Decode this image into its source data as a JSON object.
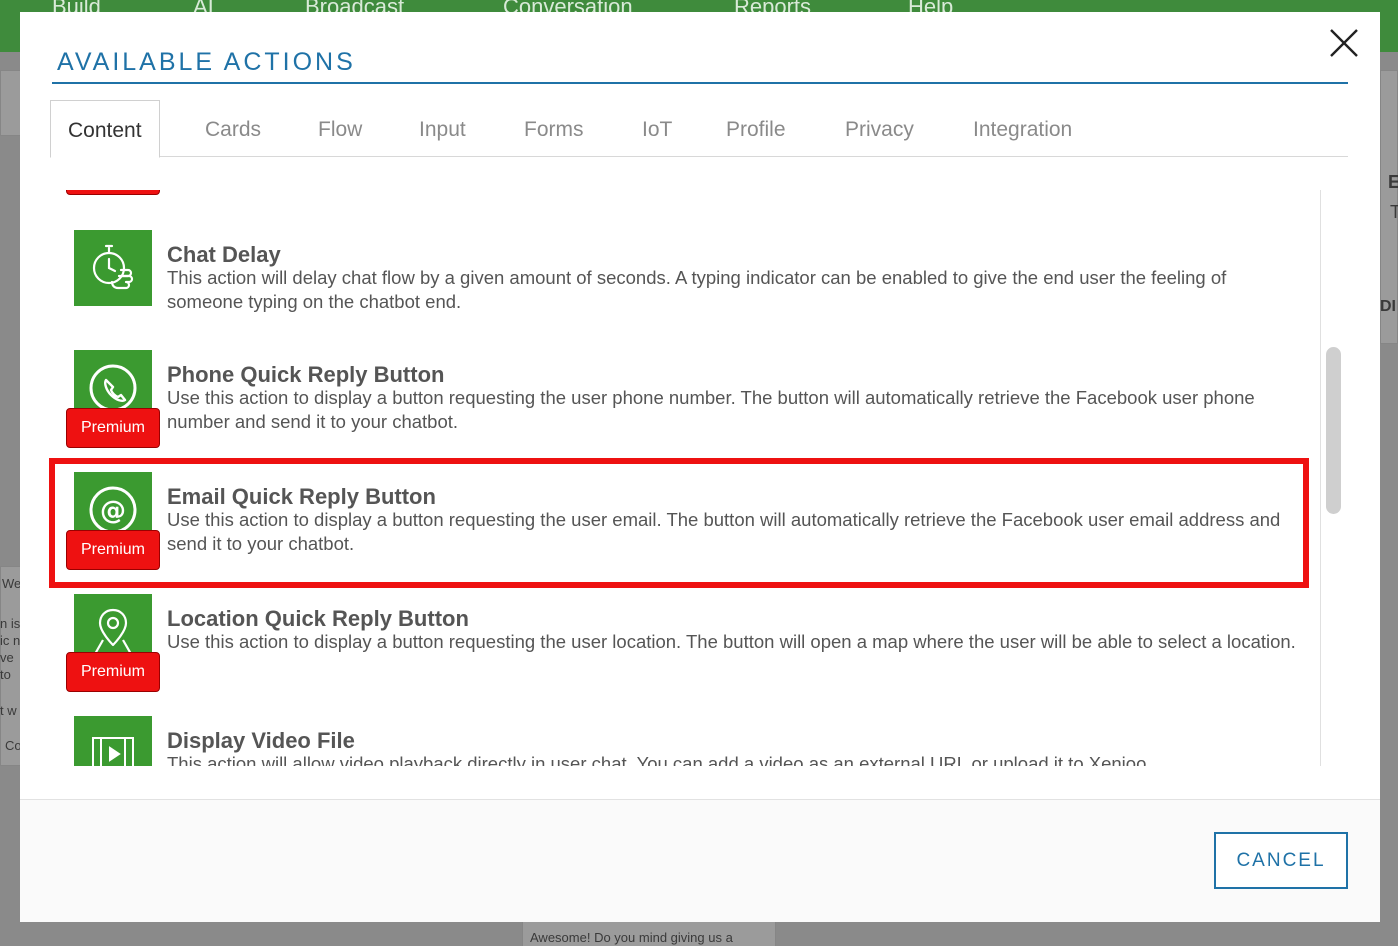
{
  "background": {
    "nav_items": [
      "Build",
      "AI",
      "Broadcast",
      "Conversation",
      "Reports",
      "Help"
    ],
    "snippets": [
      "We",
      "n is",
      "ic no",
      "ve",
      "to",
      "t w",
      "Co",
      "Awesome! Do you mind giving us a",
      "E",
      "T",
      "DI"
    ]
  },
  "modal": {
    "title": "AVAILABLE ACTIONS",
    "close_icon": "close-icon",
    "tabs": [
      {
        "label": "Content",
        "active": true
      },
      {
        "label": "Cards"
      },
      {
        "label": "Flow"
      },
      {
        "label": "Input"
      },
      {
        "label": "Forms"
      },
      {
        "label": "IoT"
      },
      {
        "label": "Profile"
      },
      {
        "label": "Privacy"
      },
      {
        "label": "Integration"
      }
    ],
    "actions": [
      {
        "name": "Chat Delay",
        "description": "This action will delay chat flow by a given amount of seconds. A typing indicator can be enabled to give the end user the feeling of someone typing on the chatbot end.",
        "icon": "stopwatch-hand-icon"
      },
      {
        "name": "Phone Quick Reply Button",
        "description": "Use this action to display a button requesting the user phone number. The button will automatically retrieve the Facebook user phone number and send it to your chatbot.",
        "icon": "phone-icon",
        "badge": "Premium"
      },
      {
        "name": "Email Quick Reply Button",
        "description": "Use this action to display a button requesting the user email. The button will automatically retrieve the Facebook user email address and send it to your chatbot.",
        "icon": "at-sign-icon",
        "badge": "Premium"
      },
      {
        "name": "Location Quick Reply Button",
        "description": "Use this action to display a button requesting the user location. The button will open a map where the user will be able to select a location.",
        "icon": "map-pin-icon",
        "badge": "Premium"
      },
      {
        "name": "Display Video File",
        "description": "This action will allow video playback directly in user chat. You can add a video as an external URL or upload it to Xenioo",
        "icon": "video-film-icon"
      }
    ],
    "cancel_label": "CANCEL"
  },
  "colors": {
    "accent": "#1f72a7",
    "icon_bg": "#3b9a30",
    "premium": "#ee1111",
    "highlight": "#ee1111"
  }
}
